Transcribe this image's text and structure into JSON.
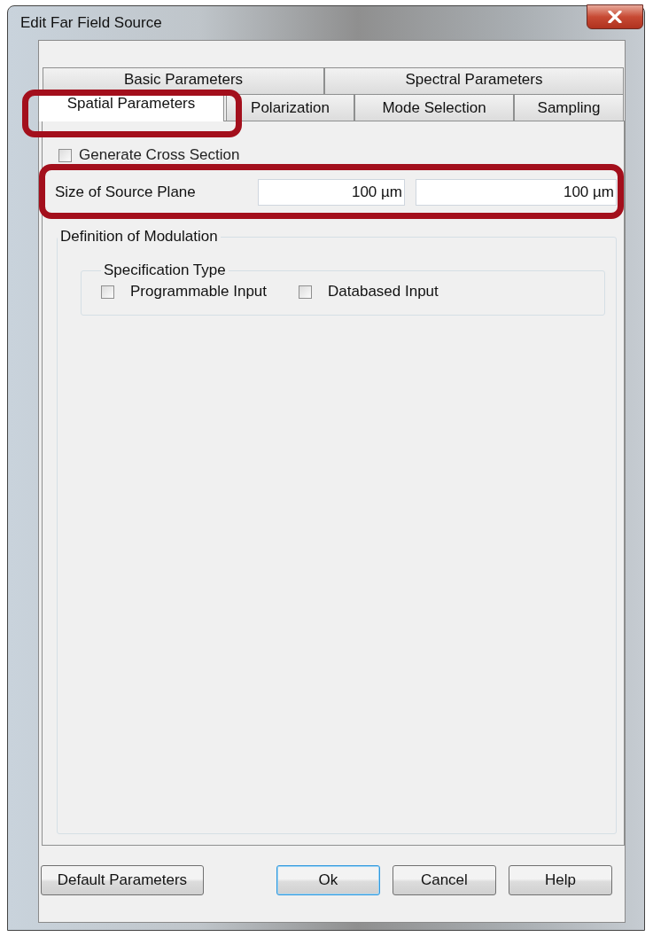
{
  "window": {
    "title": "Edit Far Field Source"
  },
  "tab_rows": [
    [
      {
        "label": "Basic Parameters",
        "selected": false,
        "highlighted": false
      },
      {
        "label": "Spectral Parameters",
        "selected": false,
        "highlighted": false
      }
    ],
    [
      {
        "label": "Spatial Parameters",
        "selected": true,
        "highlighted": true
      },
      {
        "label": "Polarization",
        "selected": false,
        "highlighted": false
      },
      {
        "label": "Mode Selection",
        "selected": false,
        "highlighted": false
      },
      {
        "label": "Sampling",
        "selected": false,
        "highlighted": false
      }
    ]
  ],
  "generate_cross_section": {
    "label": "Generate Cross Section",
    "checked": false
  },
  "source_plane": {
    "label": "Size of Source Plane",
    "values": [
      "100 µm",
      "100 µm"
    ],
    "highlighted": true
  },
  "modulation": {
    "title": "Definition of Modulation",
    "specification_type": {
      "title": "Specification Type",
      "options": [
        {
          "label": "Programmable Input",
          "checked": false
        },
        {
          "label": "Databased Input",
          "checked": false
        }
      ]
    }
  },
  "buttons": [
    {
      "label": "Default Parameters",
      "default": false
    },
    {
      "label": "Ok",
      "default": true
    },
    {
      "label": "Cancel",
      "default": false
    },
    {
      "label": "Help",
      "default": false
    }
  ]
}
